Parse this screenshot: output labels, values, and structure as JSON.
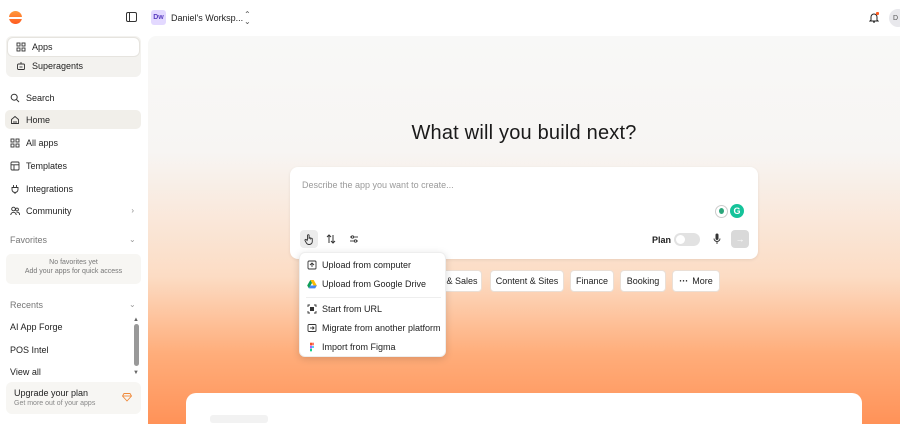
{
  "topbar": {
    "workspace_initials": "Dw",
    "workspace_name": "Daniel's Worksp...",
    "user_initial": "D"
  },
  "sidebar": {
    "segment": [
      {
        "label": "Apps",
        "icon": "grid-icon",
        "active": true
      },
      {
        "label": "Superagents",
        "icon": "bot-icon",
        "active": false
      }
    ],
    "nav": [
      {
        "label": "Search",
        "icon": "search-icon"
      },
      {
        "label": "Home",
        "icon": "home-icon",
        "active": true
      },
      {
        "label": "All apps",
        "icon": "grid-icon"
      },
      {
        "label": "Templates",
        "icon": "template-icon"
      },
      {
        "label": "Integrations",
        "icon": "plug-icon"
      },
      {
        "label": "Community",
        "icon": "people-icon"
      }
    ],
    "favorites_label": "Favorites",
    "favorites_empty_line1": "No favorites yet",
    "favorites_empty_line2": "Add your apps for quick access",
    "recents_label": "Recents",
    "recents": [
      "AI App Forge",
      "POS Intel"
    ],
    "view_all": "View all",
    "upgrade_title": "Upgrade your plan",
    "upgrade_subtitle": "Get more out of your apps"
  },
  "main": {
    "headline": "What will you build next?",
    "prompt_placeholder": "Describe the app you want to create...",
    "plan_label": "Plan",
    "plan_enabled": false,
    "chips": [
      "& Sales",
      "Content & Sites",
      "Finance",
      "Booking",
      "More"
    ]
  },
  "dropdown": {
    "items": [
      {
        "label": "Upload from computer",
        "icon": "upload-icon"
      },
      {
        "label": "Upload from Google Drive",
        "icon": "google-drive-icon"
      },
      {
        "label": "Start from URL",
        "icon": "url-scan-icon"
      },
      {
        "label": "Migrate from another platform",
        "icon": "migrate-icon"
      },
      {
        "label": "Import from Figma",
        "icon": "figma-icon"
      }
    ]
  },
  "colors": {
    "accent": "#ff5a1f",
    "grammarly": "#15c39a"
  }
}
